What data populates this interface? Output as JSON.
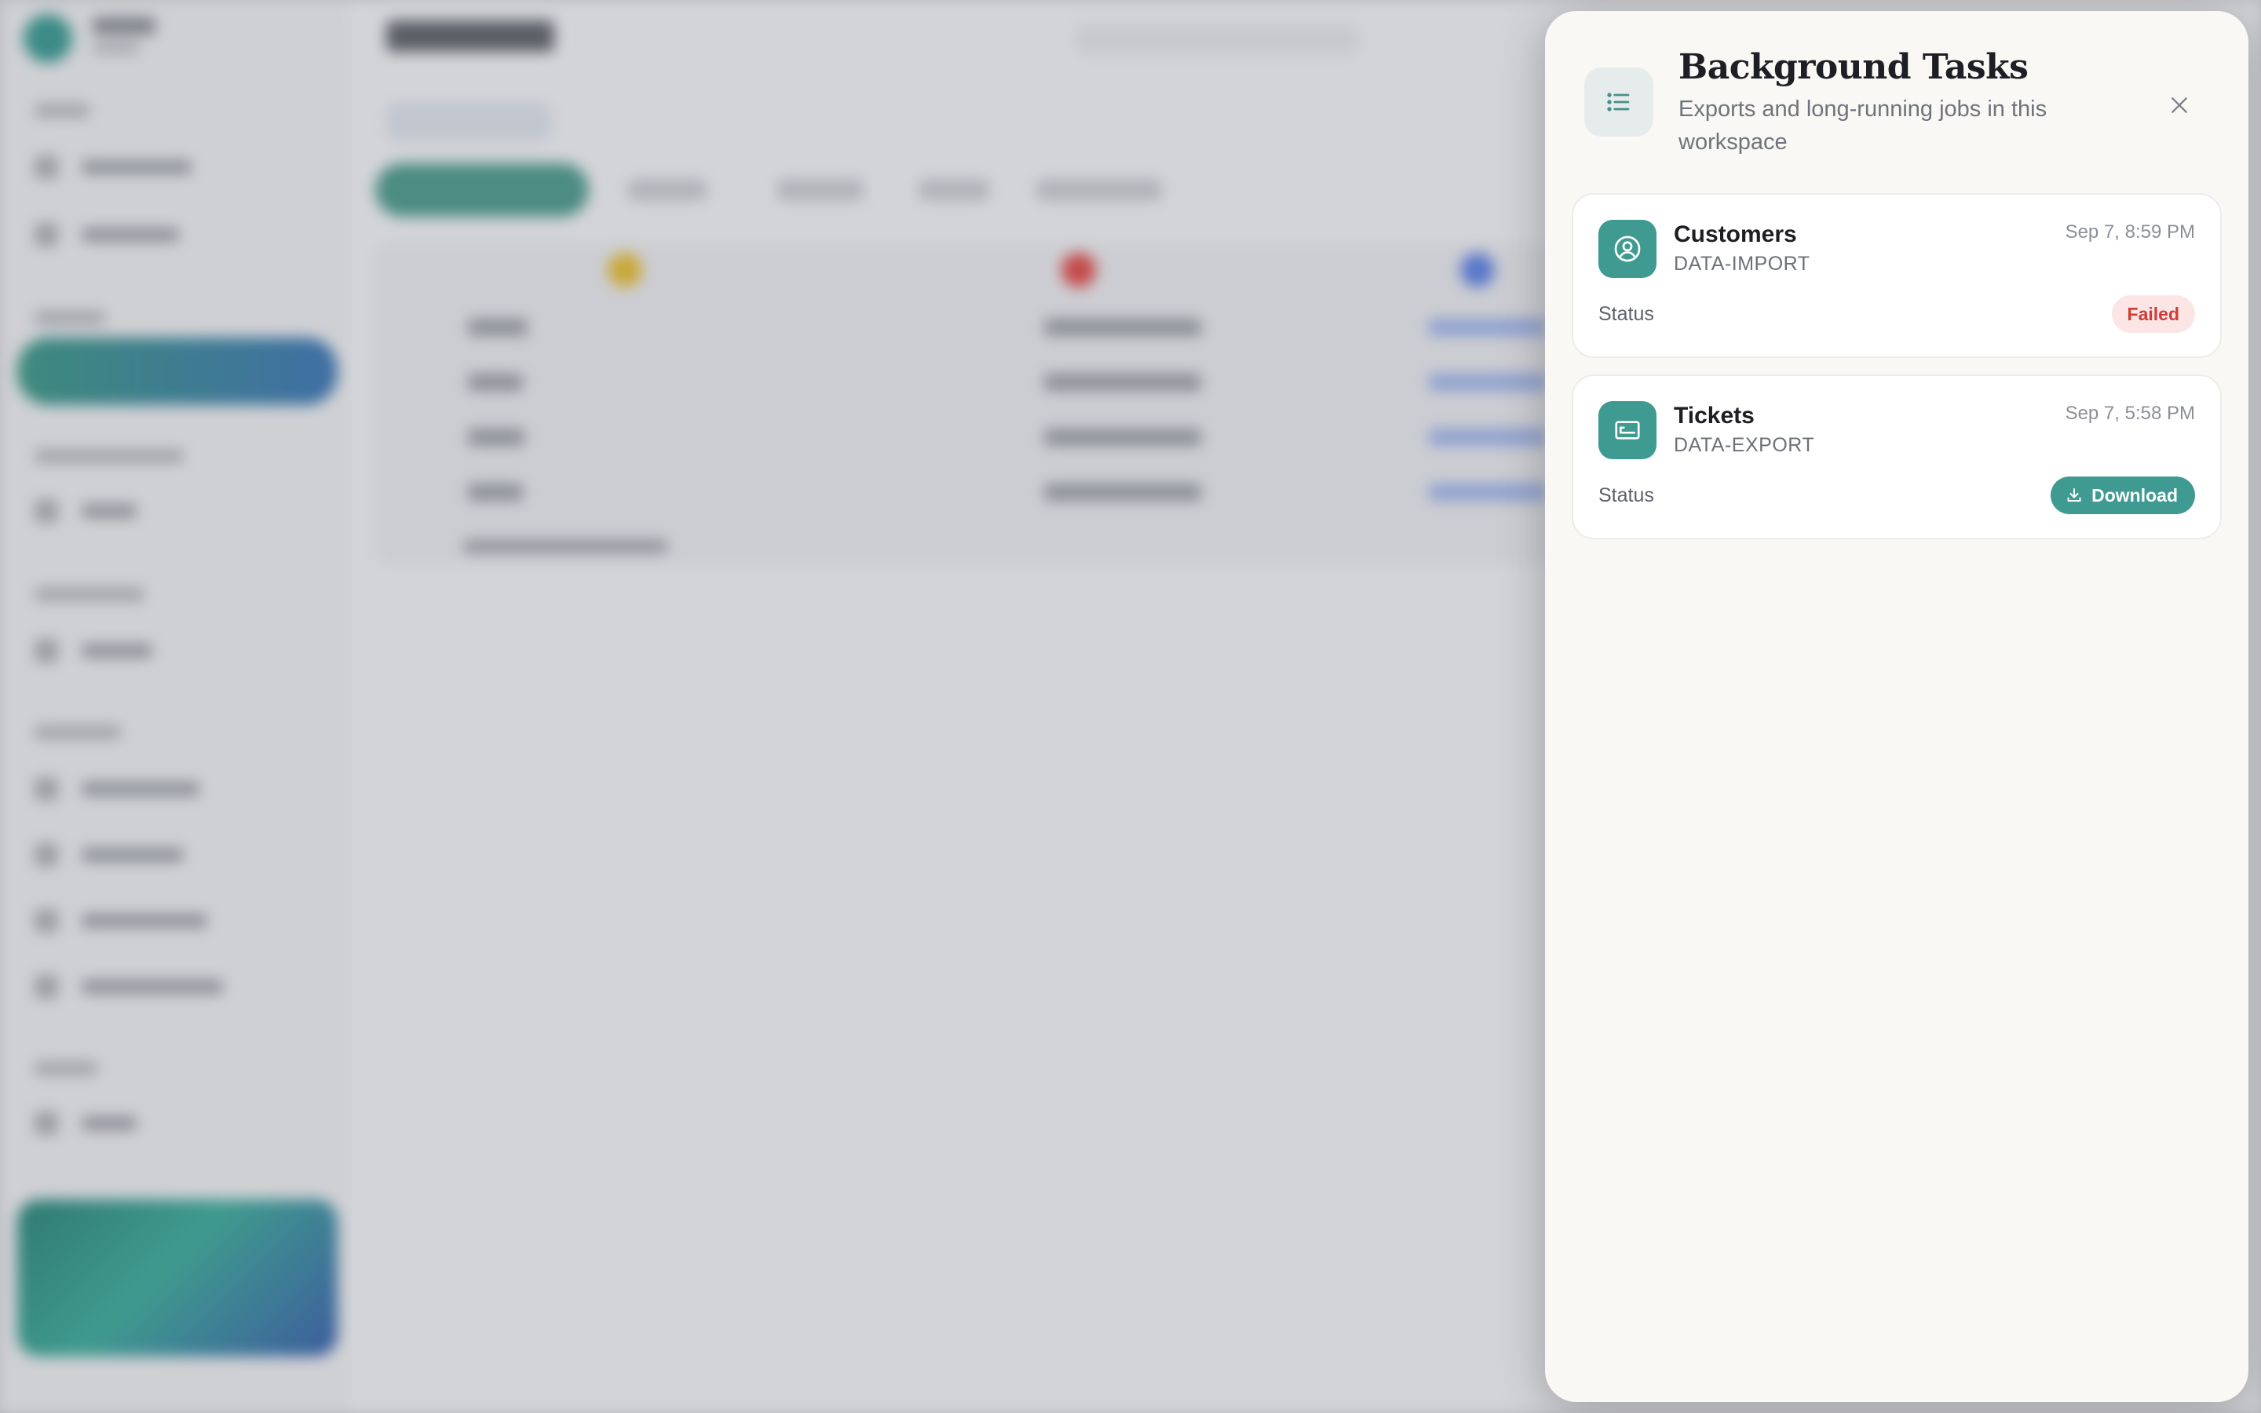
{
  "drawer": {
    "title": "Background Tasks",
    "subtitle": "Exports and long-running jobs in this workspace",
    "icon": "list-icon",
    "close_icon": "close-icon"
  },
  "tasks": [
    {
      "name": "Customers",
      "type": "DATA-IMPORT",
      "time": "Sep 7, 8:59 PM",
      "status_label": "Status",
      "status": "Failed",
      "icon": "user-circle-icon"
    },
    {
      "name": "Tickets",
      "type": "DATA-EXPORT",
      "time": "Sep 7, 5:58 PM",
      "status_label": "Status",
      "action": "Download",
      "icon": "ticket-icon"
    }
  ],
  "colors": {
    "accent": "#3f9a92",
    "failed_bg": "#fbe6e5",
    "failed_text": "#cf3b36",
    "drawer_bg": "#f9f8f5"
  }
}
